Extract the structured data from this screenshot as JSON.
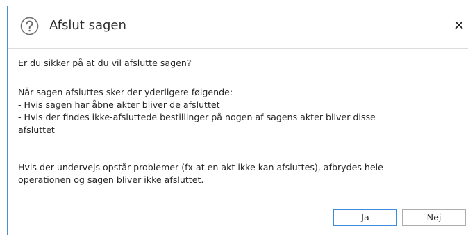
{
  "dialog": {
    "title": "Afslut sagen",
    "question": "Er du sikker på at du vil afslutte sagen?",
    "info_intro": "Når sagen afsluttes sker der yderligere følgende:",
    "info_item_1": " - Hvis sagen har åbne akter bliver de afsluttet",
    "info_item_2_line1": " - Hvis der findes ikke-afsluttede bestillinger på nogen af sagens akter bliver disse",
    "info_item_2_line2": "afsluttet",
    "warning_line1": "Hvis der undervejs opstår problemer (fx at en akt ikke kan afsluttes), afbrydes hele",
    "warning_line2": "operationen og sagen bliver ikke afsluttet.",
    "yes_label": "Ja",
    "no_label": "Nej",
    "close_symbol": "×"
  },
  "icons": {
    "help": "help-icon",
    "close": "close-icon"
  },
  "colors": {
    "accent": "#3c8dde",
    "border_default": "#adadad",
    "divider": "#dcdcdc",
    "icon_gray": "#6e6e6e"
  }
}
